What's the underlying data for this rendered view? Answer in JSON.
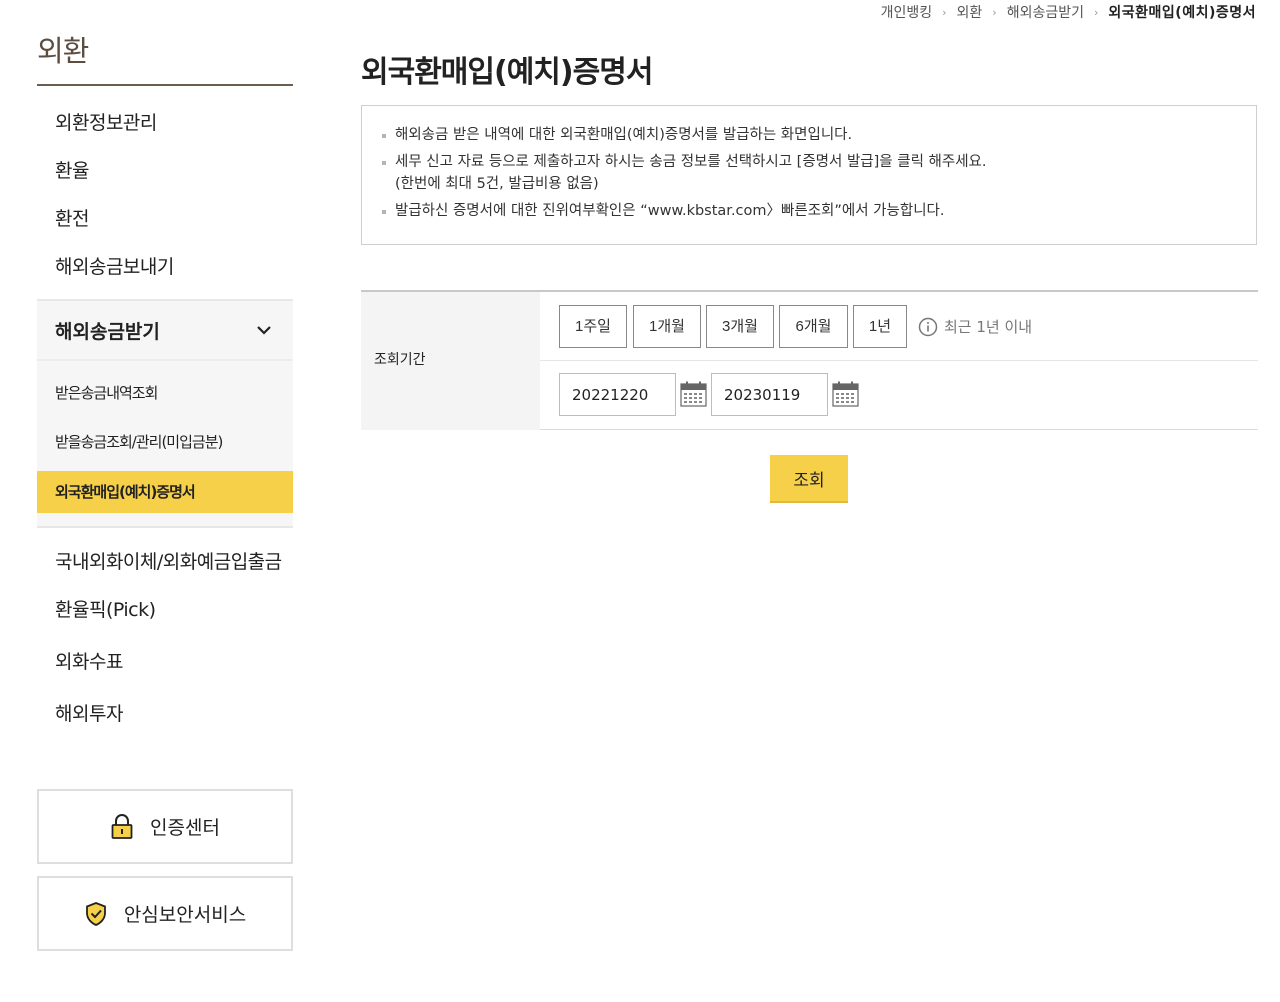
{
  "breadcrumb": {
    "items": [
      "개인뱅킹",
      "외환",
      "해외송금받기"
    ],
    "current": "외국환매입(예치)증명서"
  },
  "sidebar": {
    "title": "외환",
    "menu": [
      "외환정보관리",
      "환율",
      "환전",
      "해외송금보내기"
    ],
    "open_group": {
      "label": "해외송금받기",
      "items": [
        "받은송금내역조회",
        "받을송금조회/관리(미입금분)",
        "외국환매입(예치)증명서"
      ],
      "active_index": 2
    },
    "menu_after": [
      "국내외화이체/외화예금입출금",
      "환율픽(Pick)",
      "외화수표",
      "해외투자"
    ],
    "buttons": {
      "auth": "인증센터",
      "secure": "안심보안서비스"
    }
  },
  "page": {
    "title": "외국환매입(예치)증명서"
  },
  "info": {
    "line1": "해외송금 받은 내역에 대한 외국환매입(예치)증명서를 발급하는 화면입니다.",
    "line2": "세무 신고 자료 등으로 제출하고자 하시는 송금 정보를 선택하시고 [증명서 발급]을 클릭 해주세요.",
    "line2_sub": "(한번에 최대 5건, 발급비용 없음)",
    "line3": "발급하신 증명서에 대한 진위여부확인은 “www.kbstar.com〉빠른조회”에서 가능합니다."
  },
  "query": {
    "label": "조회기간",
    "periods": [
      "1주일",
      "1개월",
      "3개월",
      "6개월",
      "1년"
    ],
    "hint": "최근 1년 이내",
    "start_date": "20221220",
    "end_date": "20230119",
    "search_label": "조회"
  },
  "colors": {
    "accent": "#f7d049",
    "title_brown": "#5b4d3f"
  }
}
